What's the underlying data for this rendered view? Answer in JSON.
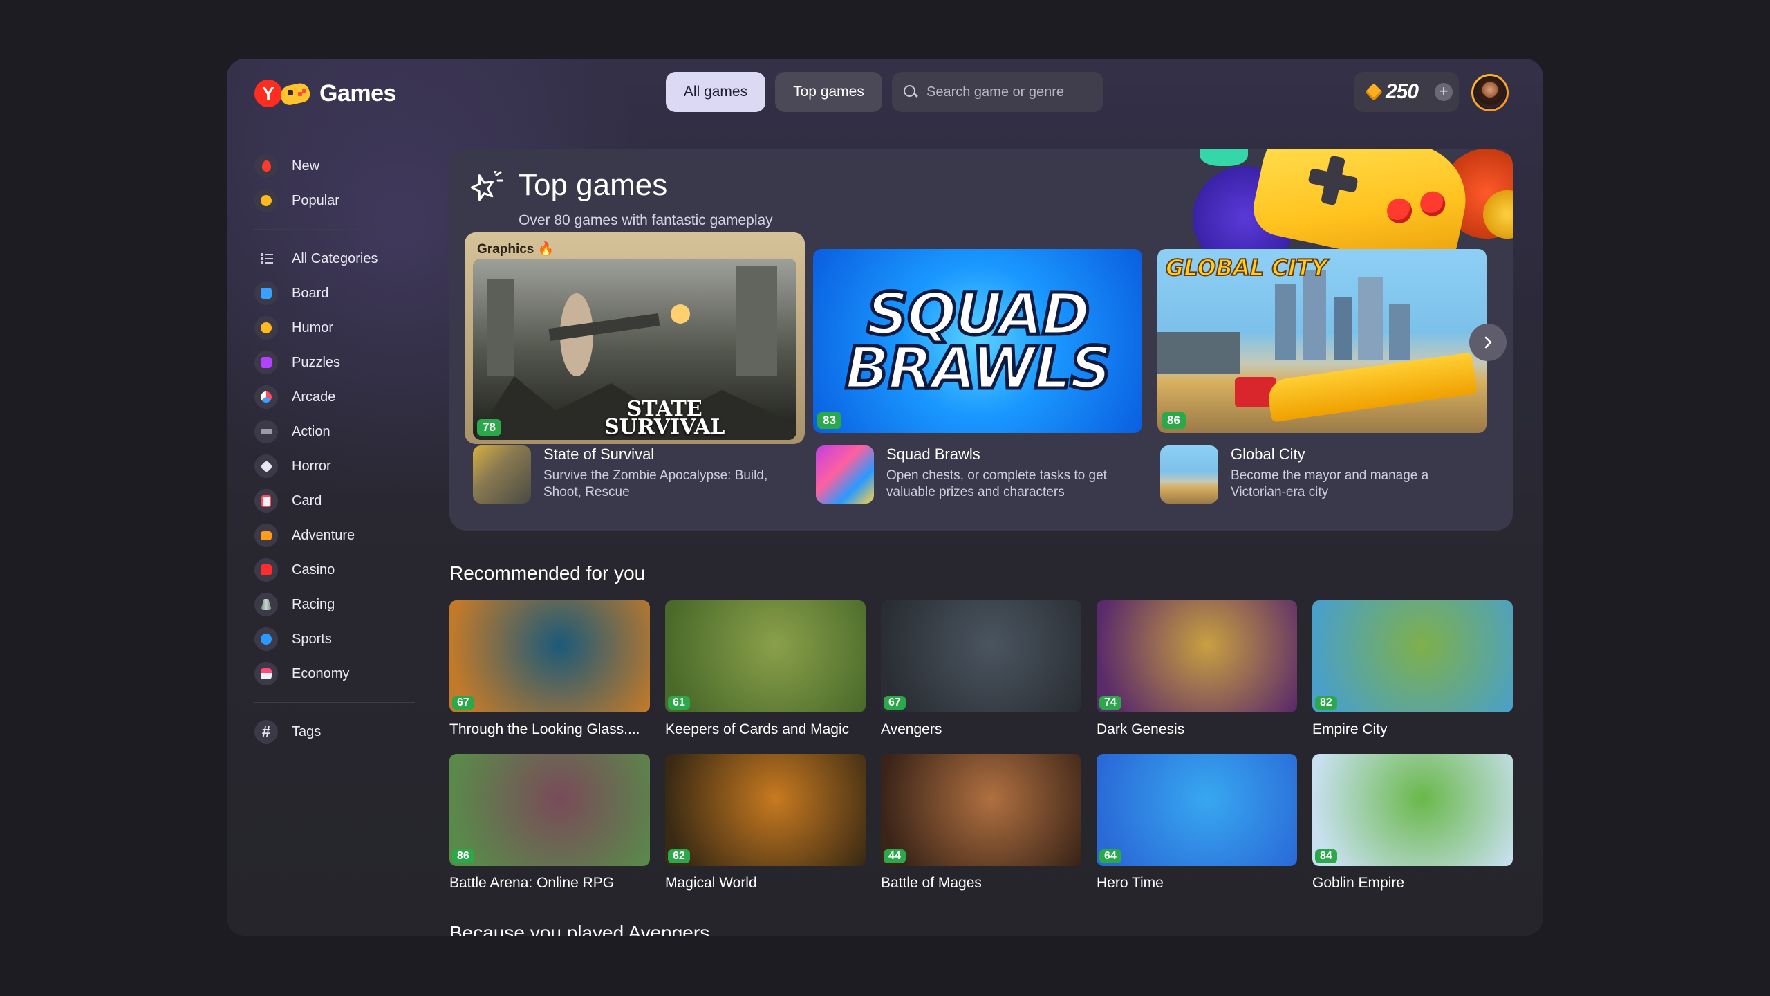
{
  "app": {
    "logo_letter": "Y",
    "title": "Games"
  },
  "header": {
    "nav_all": "All games",
    "nav_top": "Top games",
    "search_placeholder": "Search game or genre",
    "coins": "250",
    "add_coins": "+"
  },
  "sidebar": {
    "items": [
      {
        "label": "New",
        "icon": "flame-icon",
        "color": "#ff3a2a"
      },
      {
        "label": "Popular",
        "icon": "sun-icon",
        "color": "#ffb81e"
      }
    ],
    "categories": [
      {
        "label": "All Categories",
        "icon": "list-icon",
        "color": "#cfcde0"
      },
      {
        "label": "Board",
        "icon": "board-icon",
        "color": "#3aa0ff"
      },
      {
        "label": "Humor",
        "icon": "smile-icon",
        "color": "#ffb81e"
      },
      {
        "label": "Puzzles",
        "icon": "puzzle-icon",
        "color": "#b342ff"
      },
      {
        "label": "Arcade",
        "icon": "arcade-icon",
        "color": "#ff4a5a"
      },
      {
        "label": "Action",
        "icon": "gun-icon",
        "color": "#9a9aa8"
      },
      {
        "label": "Horror",
        "icon": "horror-icon",
        "color": "#e8e6f0"
      },
      {
        "label": "Card",
        "icon": "card-icon",
        "color": "#ff4a5a"
      },
      {
        "label": "Adventure",
        "icon": "chest-icon",
        "color": "#ff9c1a"
      },
      {
        "label": "Casino",
        "icon": "slot-icon",
        "color": "#ff2d2d"
      },
      {
        "label": "Racing",
        "icon": "road-icon",
        "color": "#6a8a78"
      },
      {
        "label": "Sports",
        "icon": "pingpong-icon",
        "color": "#2a9aff"
      },
      {
        "label": "Economy",
        "icon": "shop-icon",
        "color": "#ff4a7a"
      }
    ],
    "tags": {
      "label": "Tags",
      "icon": "hash-icon"
    }
  },
  "top_games": {
    "title": "Top games",
    "subtitle": "Over 80 games with fantastic gameplay",
    "badge": "Graphics",
    "cards": [
      {
        "name": "State of Survival",
        "desc": "Survive the Zombie Apocalypse: Build, Shoot, Rescue",
        "score": "78",
        "logo": "STATE SURVIVAL"
      },
      {
        "name": "Squad Brawls",
        "desc": "Open chests, or complete tasks to get valuable prizes and characters",
        "score": "83",
        "logo": "SQUAD BRAWLS"
      },
      {
        "name": "Global City",
        "desc": "Become the mayor and manage a Victorian-era city",
        "score": "86",
        "logo": "GLOBAL CITY"
      }
    ]
  },
  "recommended": {
    "title": "Recommended for you",
    "games": [
      {
        "name": "Through the Looking Glass....",
        "score": "67",
        "c1": "#1b5a7a",
        "c2": "#c27a2a"
      },
      {
        "name": "Keepers of Cards and Magic",
        "score": "61",
        "c1": "#8aa04a",
        "c2": "#4a6a2a"
      },
      {
        "name": "Avengers",
        "score": "67",
        "c1": "#4a5560",
        "c2": "#2a2e34"
      },
      {
        "name": "Dark Genesis",
        "score": "74",
        "c1": "#c9a040",
        "c2": "#5a2a6a"
      },
      {
        "name": "Empire City",
        "score": "82",
        "c1": "#7fb04a",
        "c2": "#4aa0c8"
      },
      {
        "name": "Battle Arena: Online RPG",
        "score": "86",
        "c1": "#7a4a5a",
        "c2": "#5a8a4a"
      },
      {
        "name": "Magical World",
        "score": "62",
        "c1": "#c87a20",
        "c2": "#3a2a14"
      },
      {
        "name": "Battle of Mages",
        "score": "44",
        "c1": "#b07040",
        "c2": "#3a2418"
      },
      {
        "name": "Hero Time",
        "score": "64",
        "c1": "#38a8f0",
        "c2": "#2a6ad8"
      },
      {
        "name": "Goblin Empire",
        "score": "84",
        "c1": "#6ab84a",
        "c2": "#c8e0f0"
      }
    ]
  },
  "section_next": {
    "title": "Because you played Avengers"
  }
}
